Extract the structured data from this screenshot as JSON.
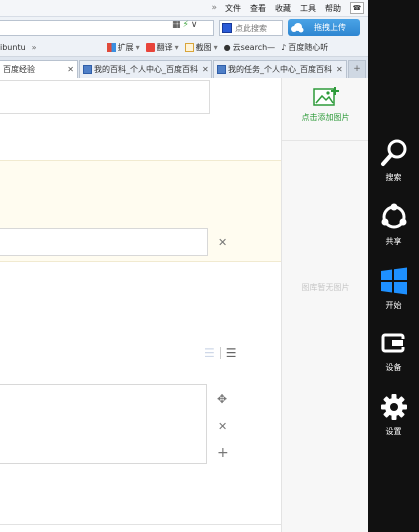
{
  "menubar": {
    "overflow": "»",
    "items": [
      "文件",
      "查看",
      "收藏",
      "工具",
      "帮助"
    ]
  },
  "search": {
    "placeholder": "点此搜索"
  },
  "upload": {
    "label": "拖拽上传"
  },
  "favbar": {
    "left_text": "ibuntu",
    "overflow": "»",
    "items": [
      {
        "label": "扩展",
        "icon": "extensions-icon"
      },
      {
        "label": "翻译",
        "icon": "translate-icon"
      },
      {
        "label": "截图",
        "icon": "screenshot-icon"
      },
      {
        "label": "云search—",
        "icon": "cloud-search-icon"
      },
      {
        "label": "百度随心听",
        "icon": "music-icon"
      }
    ]
  },
  "tabs": [
    {
      "label": "百度经验",
      "active": true
    },
    {
      "label": "我的百科_个人中心_百度百科",
      "active": false
    },
    {
      "label": "我的任务_个人中心_百度百科",
      "active": false
    }
  ],
  "sidepanel": {
    "add_picture": "点击添加图片",
    "empty": "图库暂无图片"
  },
  "charms": [
    {
      "label": "搜索",
      "icon": "search-icon"
    },
    {
      "label": "共享",
      "icon": "share-icon"
    },
    {
      "label": "开始",
      "icon": "windows-icon"
    },
    {
      "label": "设备",
      "icon": "devices-icon"
    },
    {
      "label": "设置",
      "icon": "settings-icon"
    }
  ],
  "colors": {
    "accent_green": "#2e9b3a",
    "upload_blue": "#2e86d1",
    "charms_bg": "#111111"
  }
}
